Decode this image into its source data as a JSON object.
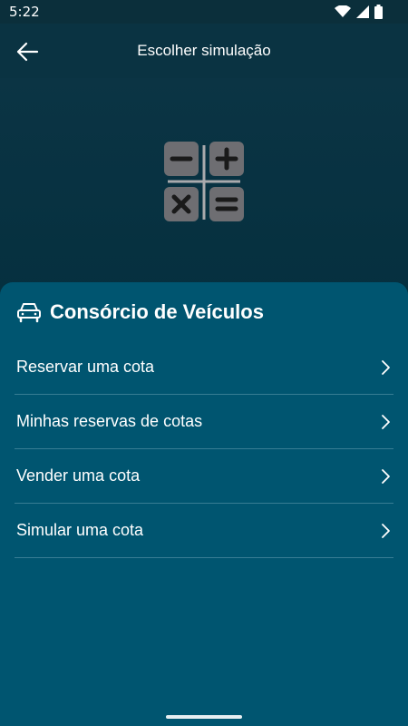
{
  "status_bar": {
    "time": "5:22",
    "icons": [
      "wifi-icon",
      "signal-icon",
      "battery-icon"
    ]
  },
  "header": {
    "back_icon": "arrow-left-icon",
    "title": "Escolher simulação"
  },
  "hero": {
    "icon": "calculator-icon"
  },
  "section": {
    "icon": "car-icon",
    "title": "Consórcio de Veículos",
    "items": [
      {
        "label": "Reservar uma cota",
        "icon": "chevron-right-icon"
      },
      {
        "label": "Minhas reservas de cotas",
        "icon": "chevron-right-icon"
      },
      {
        "label": "Vender uma cota",
        "icon": "chevron-right-icon"
      },
      {
        "label": "Simular uma cota",
        "icon": "chevron-right-icon"
      }
    ]
  },
  "colors": {
    "background": "#083746",
    "header": "#0a3342",
    "sheet": "#005570",
    "text": "#ffffff",
    "icon_gray": "#6e6e72"
  }
}
